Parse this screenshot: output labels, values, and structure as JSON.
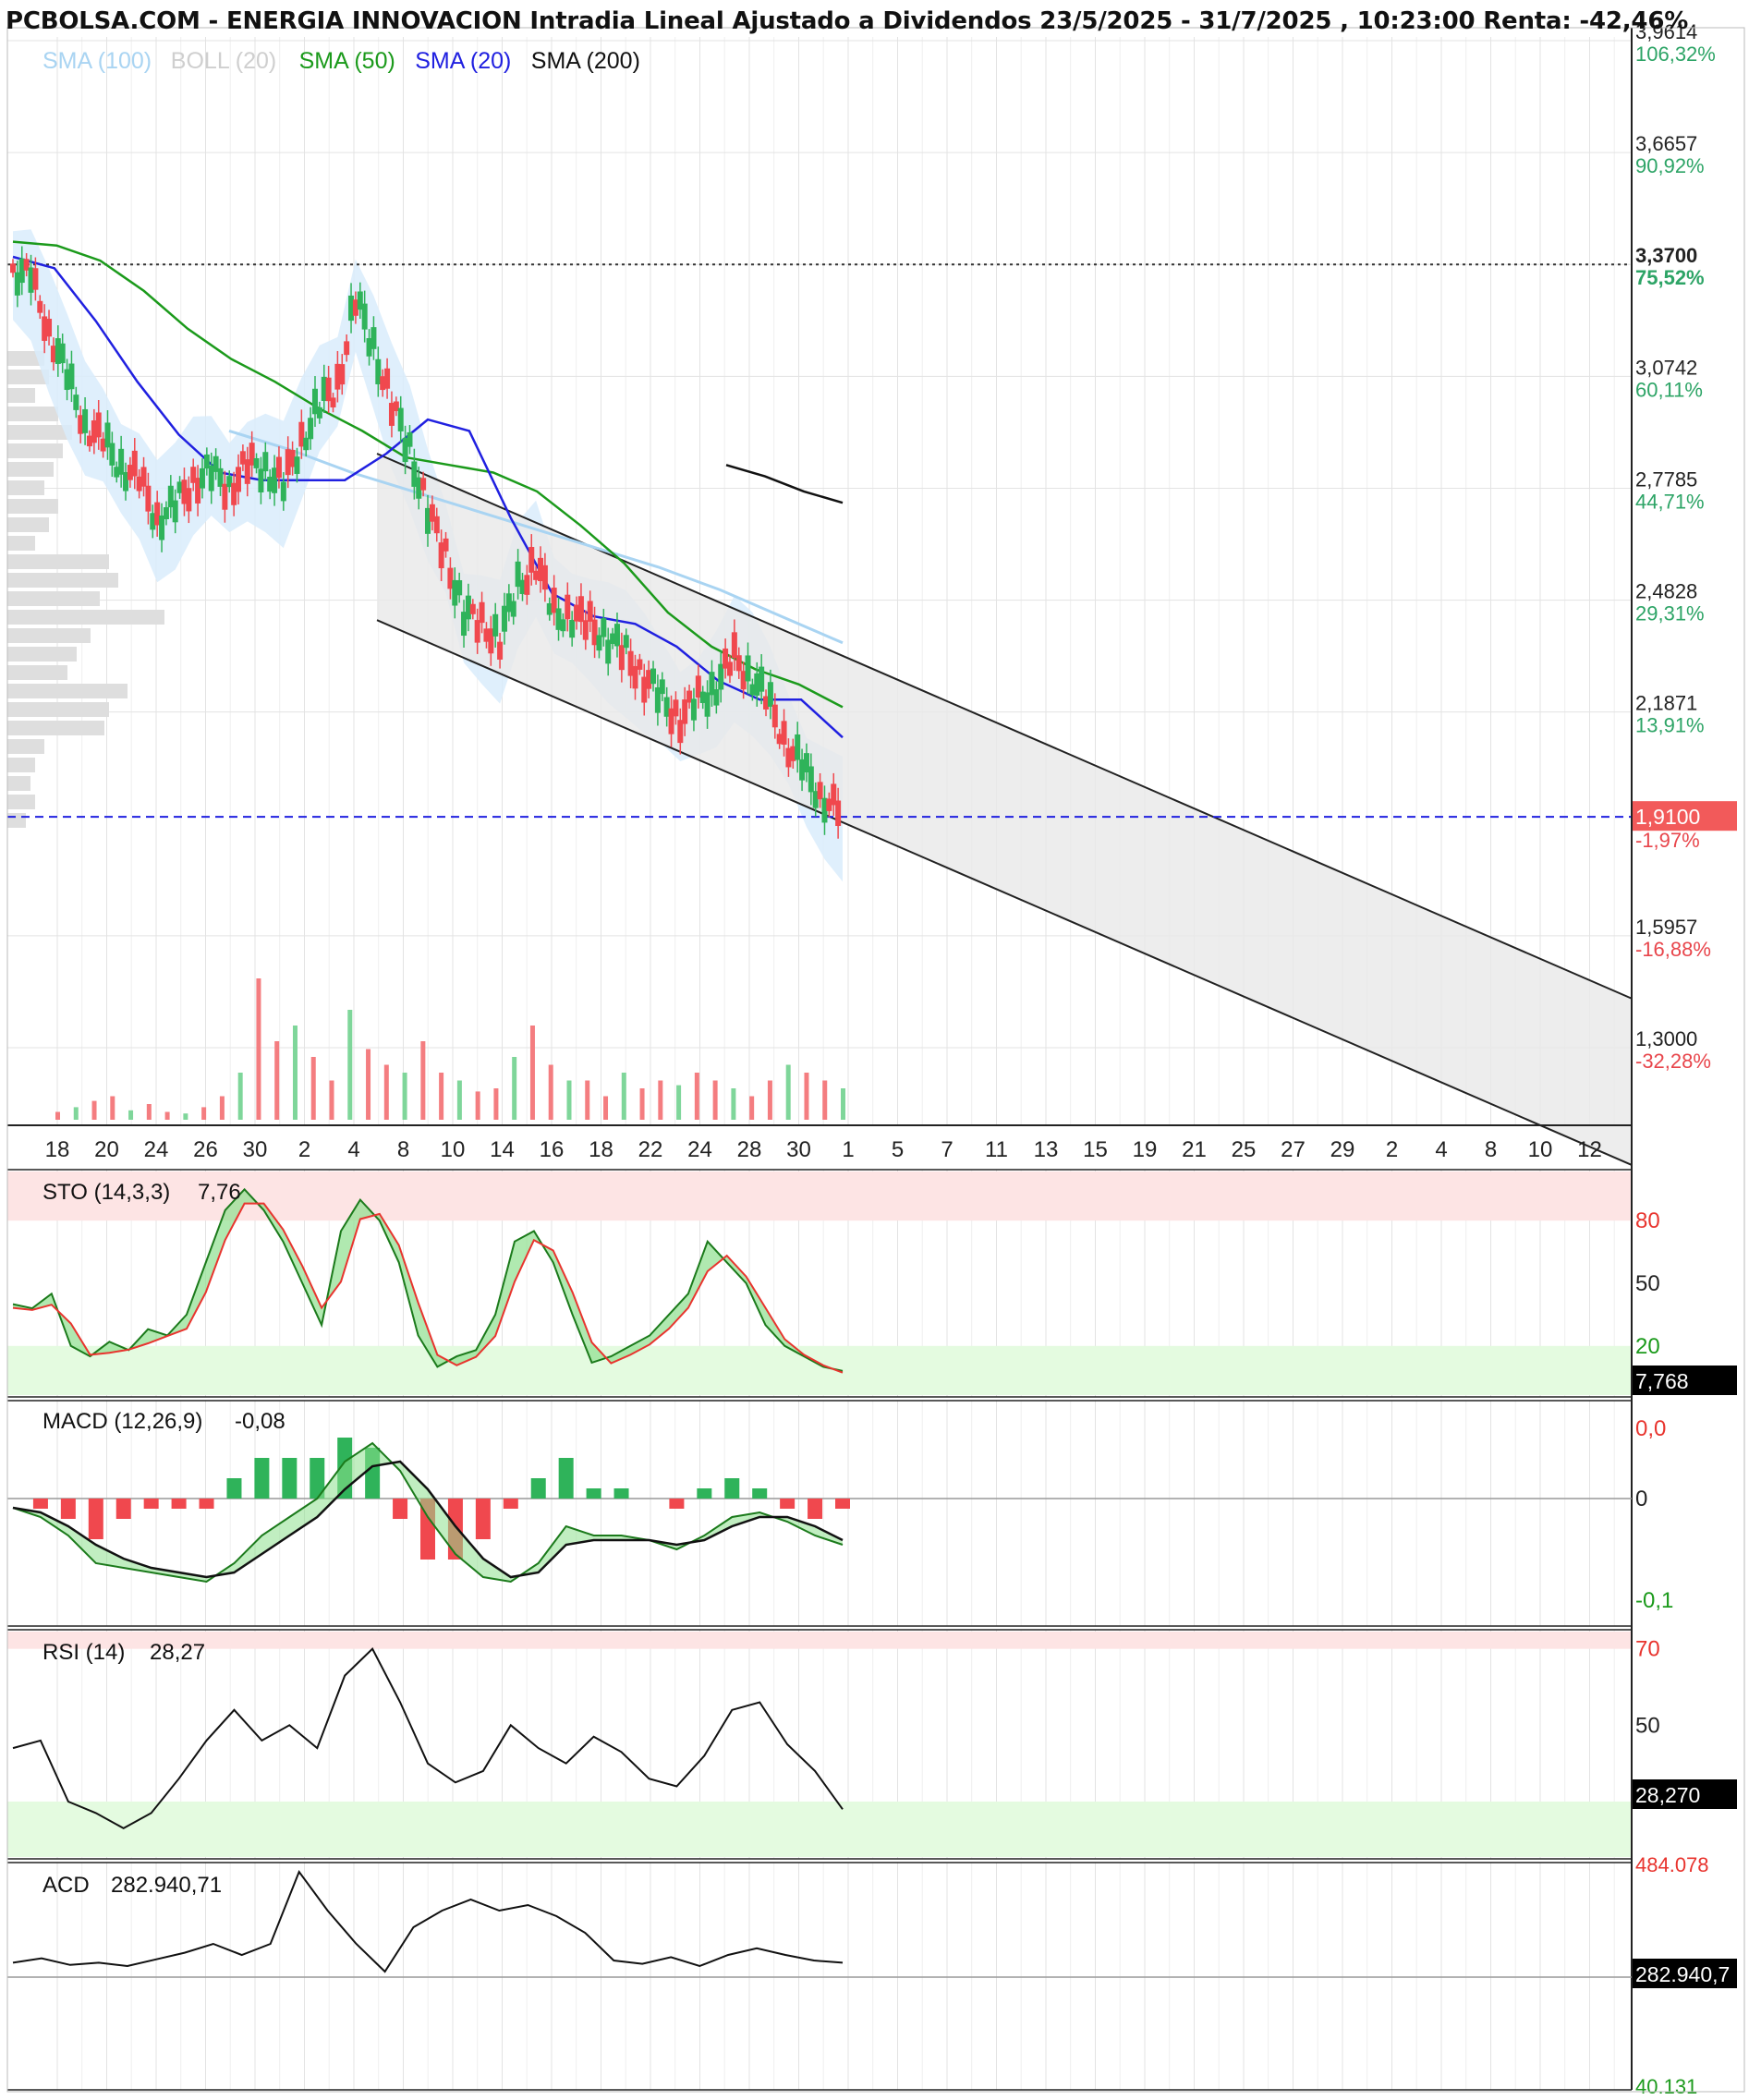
{
  "header": {
    "title": "PCBOLSA.COM - ENERGIA INNOVACION Intradia Lineal Ajustado a Dividendos 23/5/2025 - 31/7/2025 , 10:23:00 Renta: -42,46%"
  },
  "colors": {
    "sma100": "#a9d4f2",
    "boll": "#cfcfcf",
    "sma50": "#1b9a1b",
    "sma20": "#2020e0",
    "sma200": "#111111",
    "up": "#2fb35a",
    "down": "#f0484e",
    "last_price_bg": "#f25a5a",
    "overbought": "#fde4e4",
    "oversold": "#e4fbe0"
  },
  "chart_data": [
    {
      "panel": "price",
      "type": "line",
      "legend": [
        {
          "name": "SMA (100)",
          "color": "#a9d4f2"
        },
        {
          "name": "BOLL (20)",
          "color": "#cfcfcf"
        },
        {
          "name": "SMA (50)",
          "color": "#1b9a1b"
        },
        {
          "name": "SMA (20)",
          "color": "#2020e0"
        },
        {
          "name": "SMA (200)",
          "color": "#111111"
        }
      ],
      "x_ticks": [
        "18",
        "20",
        "24",
        "26",
        "30",
        "2",
        "4",
        "8",
        "10",
        "14",
        "16",
        "18",
        "22",
        "24",
        "28",
        "30",
        "1",
        "5",
        "7",
        "11",
        "13",
        "15",
        "19",
        "21",
        "25",
        "27",
        "29",
        "2",
        "4",
        "8",
        "10",
        "12"
      ],
      "y_ticks": [
        {
          "price": "3,9614",
          "pct": "106,32%"
        },
        {
          "price": "3,6657",
          "pct": "90,92%"
        },
        {
          "price": "3,3700",
          "pct": "75,52%"
        },
        {
          "price": "3,0742",
          "pct": "60,11%"
        },
        {
          "price": "2,7785",
          "pct": "44,71%"
        },
        {
          "price": "2,4828",
          "pct": "29,31%"
        },
        {
          "price": "2,1871",
          "pct": "13,91%"
        },
        {
          "price": "1,5957",
          "pct": "-16,88%"
        },
        {
          "price": "1,3000",
          "pct": "-32,28%"
        }
      ],
      "y_values": [
        3.9614,
        3.6657,
        3.37,
        3.0742,
        2.7785,
        2.4828,
        2.1871,
        1.5957,
        1.3
      ],
      "reference_line": {
        "price_value": 3.37
      },
      "last_price": {
        "label": "1,9100",
        "pct": "-1,97%",
        "value": 1.91
      },
      "close_path": [
        3.36,
        3.33,
        3.2,
        3.07,
        2.95,
        2.9,
        2.84,
        2.8,
        2.7,
        2.73,
        2.8,
        2.82,
        2.78,
        2.84,
        2.83,
        2.79,
        2.9,
        3.0,
        3.05,
        3.28,
        3.15,
        3.0,
        2.88,
        2.72,
        2.6,
        2.45,
        2.42,
        2.38,
        2.52,
        2.58,
        2.45,
        2.44,
        2.42,
        2.38,
        2.34,
        2.28,
        2.22,
        2.17,
        2.22,
        2.26,
        2.33,
        2.28,
        2.2,
        2.1,
        2.02,
        1.96,
        1.91
      ],
      "channel": {
        "upper": [
          2.87,
          1.43
        ],
        "lower": [
          2.43,
          0.99
        ]
      },
      "volume": [
        0.05,
        0.08,
        0.12,
        0.15,
        0.06,
        0.1,
        0.05,
        0.04,
        0.08,
        0.15,
        0.3,
        0.9,
        0.5,
        0.6,
        0.4,
        0.25,
        0.7,
        0.45,
        0.35,
        0.3,
        0.5,
        0.3,
        0.25,
        0.18,
        0.2,
        0.4,
        0.6,
        0.35,
        0.25,
        0.25,
        0.15,
        0.3,
        0.2,
        0.25,
        0.22,
        0.3,
        0.25,
        0.2,
        0.15,
        0.25,
        0.35,
        0.3,
        0.25,
        0.2
      ]
    },
    {
      "panel": "stochastic",
      "type": "line",
      "label": "STO (14,3,3)",
      "value_text": "7,76",
      "last_label": "7,768",
      "y_ticks": [
        "80",
        "50",
        "20"
      ],
      "y_values": [
        80,
        50,
        20
      ],
      "k": [
        40,
        38,
        45,
        20,
        15,
        22,
        18,
        28,
        25,
        35,
        60,
        85,
        95,
        85,
        70,
        50,
        30,
        75,
        90,
        80,
        60,
        25,
        10,
        15,
        18,
        35,
        70,
        75,
        60,
        35,
        12,
        15,
        20,
        25,
        35,
        45,
        70,
        60,
        50,
        30,
        20,
        15,
        10,
        8
      ]
    },
    {
      "panel": "macd",
      "type": "line",
      "label": "MACD (12,26,9)",
      "value_text": "-0,08",
      "y_ticks": [
        "0,0",
        "0",
        "-0,1"
      ],
      "macd": [
        -0.01,
        -0.02,
        -0.04,
        -0.07,
        -0.075,
        -0.08,
        -0.085,
        -0.09,
        -0.07,
        -0.04,
        -0.02,
        0.0,
        0.04,
        0.06,
        0.03,
        -0.02,
        -0.06,
        -0.085,
        -0.09,
        -0.07,
        -0.03,
        -0.04,
        -0.04,
        -0.045,
        -0.055,
        -0.04,
        -0.02,
        -0.015,
        -0.025,
        -0.04,
        -0.05
      ],
      "signal": [
        -0.01,
        -0.015,
        -0.03,
        -0.05,
        -0.065,
        -0.075,
        -0.08,
        -0.085,
        -0.08,
        -0.06,
        -0.04,
        -0.02,
        0.01,
        0.035,
        0.04,
        0.01,
        -0.03,
        -0.065,
        -0.085,
        -0.08,
        -0.05,
        -0.045,
        -0.045,
        -0.045,
        -0.05,
        -0.045,
        -0.03,
        -0.02,
        -0.02,
        -0.03,
        -0.045
      ]
    },
    {
      "panel": "rsi",
      "type": "line",
      "label": "RSI (14)",
      "value_text": "28,27",
      "last_label": "28,270",
      "y_ticks": [
        "70",
        "50"
      ],
      "y_values": [
        70,
        50
      ],
      "rsi": [
        44,
        46,
        30,
        27,
        23,
        27,
        36,
        46,
        54,
        46,
        50,
        44,
        63,
        70,
        56,
        40,
        35,
        38,
        50,
        44,
        40,
        47,
        43,
        36,
        34,
        42,
        54,
        56,
        45,
        38,
        28
      ]
    },
    {
      "panel": "acd",
      "type": "line",
      "label": "ACD",
      "value_text": "282.940,71",
      "last_label": "282.940,7",
      "top_label": "484.078",
      "bottom_label": "40.131",
      "acd": [
        0.13,
        0.17,
        0.11,
        0.13,
        0.1,
        0.16,
        0.22,
        0.3,
        0.2,
        0.3,
        0.95,
        0.6,
        0.3,
        0.05,
        0.45,
        0.6,
        0.7,
        0.6,
        0.65,
        0.55,
        0.4,
        0.15,
        0.12,
        0.18,
        0.1,
        0.2,
        0.26,
        0.2,
        0.15,
        0.13
      ]
    }
  ]
}
